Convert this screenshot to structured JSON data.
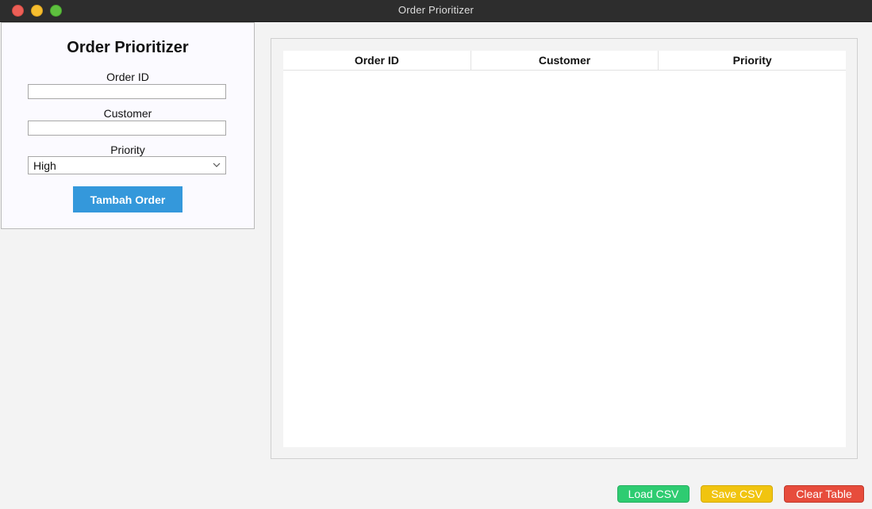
{
  "window": {
    "title": "Order Prioritizer"
  },
  "form": {
    "title": "Order Prioritizer",
    "order_id_label": "Order ID",
    "order_id_value": "",
    "customer_label": "Customer",
    "customer_value": "",
    "priority_label": "Priority",
    "priority_selected": "High",
    "add_button_label": "Tambah Order"
  },
  "table": {
    "columns": [
      "Order ID",
      "Customer",
      "Priority"
    ],
    "rows": []
  },
  "actions": {
    "load_label": "Load CSV",
    "save_label": "Save CSV",
    "clear_label": "Clear Table"
  },
  "colors": {
    "add_button": "#3498db",
    "load_button": "#2ecc71",
    "save_button": "#f1c40f",
    "clear_button": "#e74c3c"
  }
}
